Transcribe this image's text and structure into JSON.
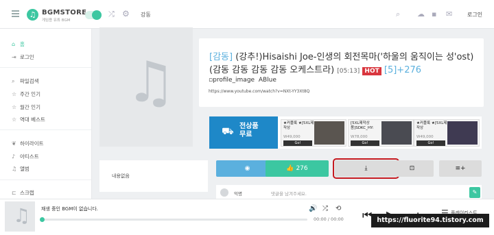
{
  "header": {
    "brand": "BGMSTORE",
    "tagline": "게임용 유튜 BGM",
    "search_text": "강동",
    "login_label": "로그인",
    "icons": [
      "menu-icon",
      "shuffle-icon",
      "gear-icon",
      "search-icon",
      "cloud-upload-icon",
      "delete-icon",
      "mail-icon"
    ]
  },
  "sidebar": {
    "items": [
      {
        "label": "홈",
        "icon": "home-icon",
        "active": true
      },
      {
        "label": "로그인",
        "icon": "login-icon"
      },
      {
        "label": "파일검색",
        "icon": "search-icon"
      },
      {
        "label": "주간 인기",
        "icon": "star-icon"
      },
      {
        "label": "월간 인기",
        "icon": "star-icon"
      },
      {
        "label": "역대 베스트",
        "icon": "star-icon"
      },
      {
        "label": "하이라이트",
        "icon": "leaf-icon"
      },
      {
        "label": "아티스트",
        "icon": "mic-icon"
      },
      {
        "label": "앨범",
        "icon": "music-note-icon"
      },
      {
        "label": "스크랩",
        "icon": "bookmark-icon"
      }
    ],
    "accent": "#3cc7a1"
  },
  "track": {
    "tag": "[감동]",
    "title_line1": "(강추!)Hisaishi Joe-인생의 회전목마('하울의 움직이는 성'ost)",
    "title_line2": "(감동 감동 감동 감동 오케스트라)",
    "duration": "[05:13]",
    "hot_badge": "HOT",
    "comment_count": "[5]",
    "likes_plus": "+276",
    "profile_text": "profile_image",
    "uploader": "ABlue",
    "url": "https://www.youtube.com/watch?v=NXt-YY3Xt8Q"
  },
  "ad": {
    "banner_text_1": "전상품",
    "banner_text_2": "무료",
    "cards": [
      {
        "title": "★커플룩 ★[5XL제작상",
        "price": "W49,000",
        "go": "Go!"
      },
      {
        "title": "[5XL제작상 품]SDKC_HY:",
        "price": "W78,000",
        "go": "Go!"
      },
      {
        "title": "★커플룩 ★[5XL제작상",
        "price": "W49,000",
        "go": "Go!"
      }
    ]
  },
  "comment_box": {
    "label": "내용없음"
  },
  "actions": {
    "like_count": "276",
    "play_icon": "play-circle-icon",
    "like_icon": "thumbs-up-icon",
    "download_icon": "download-icon",
    "save_icon": "save-box-icon",
    "add_icon": "playlist-add-icon",
    "highlight_color": "#c5191f"
  },
  "comment_row": {
    "anonymous": "익명",
    "placeholder": "댓글을 남겨주세요."
  },
  "player": {
    "status": "재생 중인 BGM이 없습니다.",
    "time": "00:00 / 00:00",
    "progress_fraction": 0,
    "queue_label": "플레이리스트"
  },
  "watermark": "https://fluorite94.tistory.com"
}
